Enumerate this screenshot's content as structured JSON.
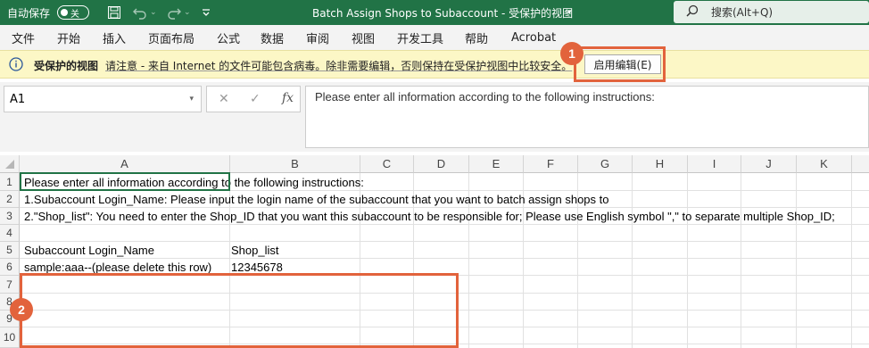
{
  "titlebar": {
    "autosave_label": "自动保存",
    "autosave_state": "关",
    "title": "Batch Assign Shops to Subaccount  -  受保护的视图",
    "search_placeholder": "搜索(Alt+Q)"
  },
  "menu": [
    "文件",
    "开始",
    "插入",
    "页面布局",
    "公式",
    "数据",
    "审阅",
    "视图",
    "开发工具",
    "帮助",
    "Acrobat"
  ],
  "infobar": {
    "title": "受保护的视图",
    "message": "请注意 - 来自 Internet 的文件可能包含病毒。除非需要编辑，否则保持在受保护视图中比较安全。",
    "enable_button": "启用编辑(E)"
  },
  "badges": [
    "1",
    "2"
  ],
  "formula_bar": {
    "name_box": "A1",
    "fx": "fx",
    "content": "Please enter all information according to the following instructions:"
  },
  "columns": [
    "A",
    "B",
    "C",
    "D",
    "E",
    "F",
    "G",
    "H",
    "I",
    "J",
    "K"
  ],
  "rows": [
    "1",
    "2",
    "3",
    "4",
    "5",
    "6",
    "7",
    "8",
    "9",
    "10"
  ],
  "cells": {
    "A1": "Please enter all information according to the following instructions:",
    "A2": "1.Subaccount Login_Name: Please input the login name of the subaccount that you want to batch assign shops to",
    "A3": "2.\"Shop_list\": You need to enter the Shop_ID that you want this subaccount to be responsible for; Please use English symbol \",\" to separate multiple Shop_ID;",
    "A5": "Subaccount Login_Name",
    "B5": "Shop_list",
    "A6": "sample:aaa--(please delete this row)",
    "B6": "12345678"
  },
  "colors": {
    "excel_green": "#217346",
    "annotation": "#e2633c",
    "infobar_bg": "#fcf7c6"
  }
}
